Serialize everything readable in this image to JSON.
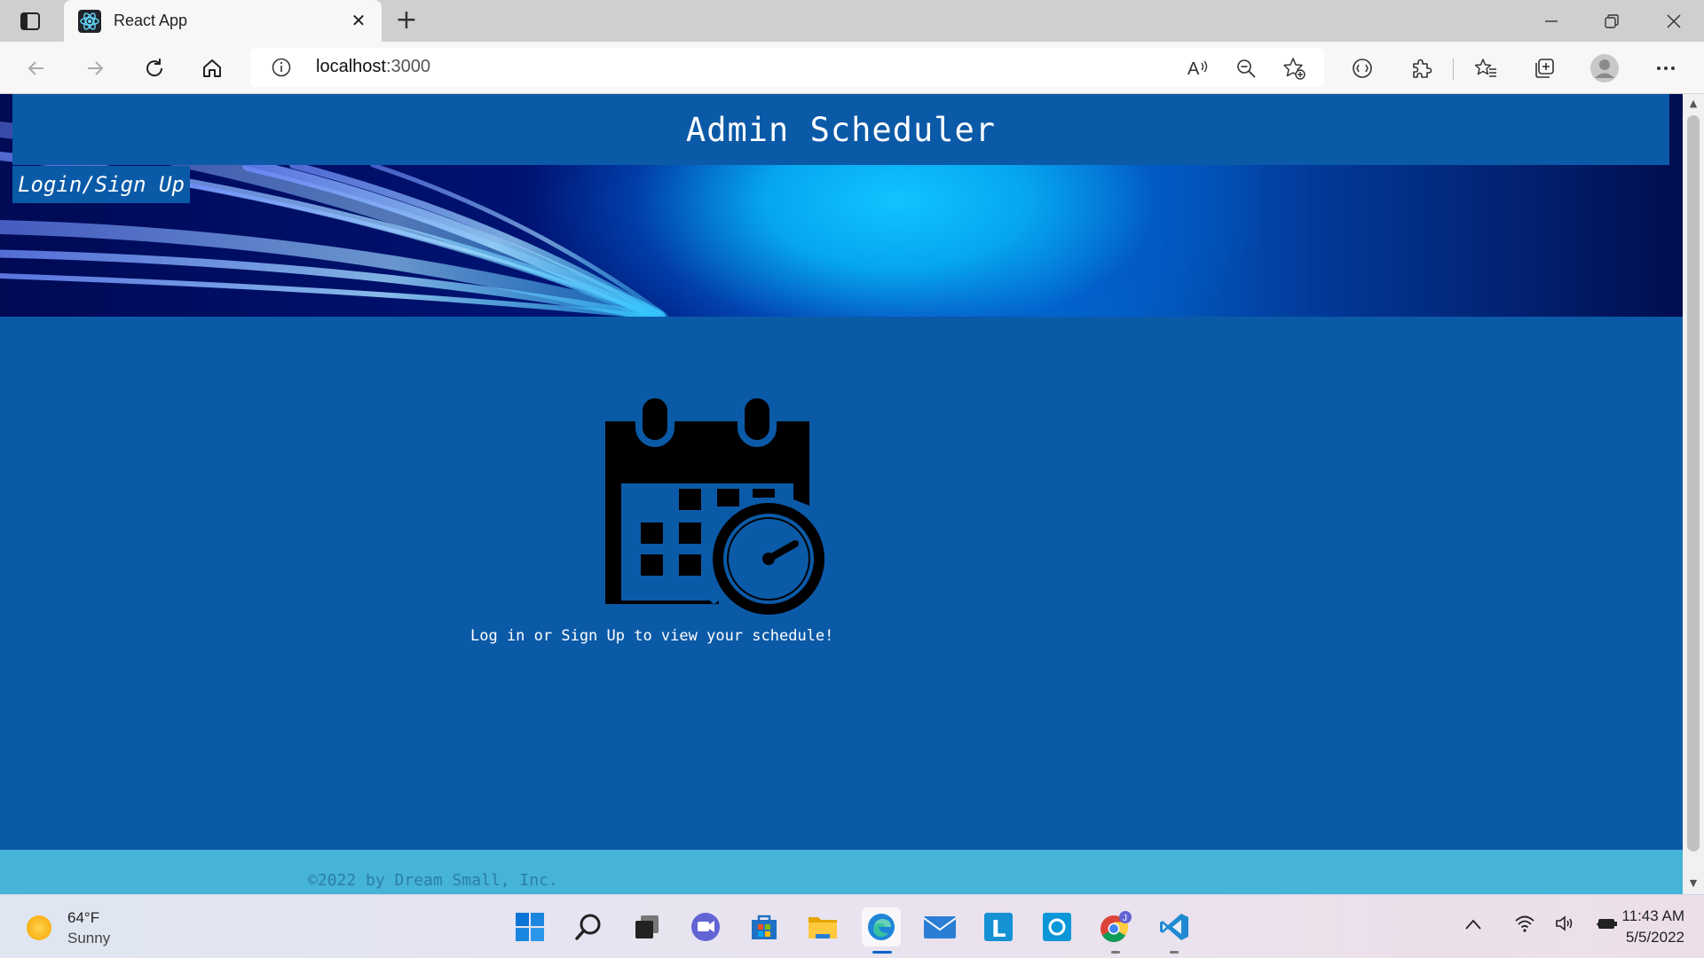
{
  "browser": {
    "tab_title": "React App",
    "new_tab_symbol": "+",
    "close_tab_symbol": "✕",
    "url_host": "localhost",
    "url_port": ":3000",
    "icons": [
      "tab-actions-icon",
      "react-favicon-icon",
      "minimize-icon",
      "restore-icon",
      "close-window-icon",
      "back-icon",
      "forward-icon",
      "refresh-icon",
      "home-icon",
      "site-info-icon",
      "read-aloud-icon",
      "zoom-out-icon",
      "add-favorite-icon",
      "tracking-icon",
      "extensions-icon",
      "favorites-icon",
      "collections-icon",
      "profile-icon",
      "more-icon"
    ]
  },
  "page": {
    "title": "Admin Scheduler",
    "login_label": "Login/Sign Up",
    "prompt": "Log in or Sign Up to view your schedule!",
    "footer": "©2022 by Dream Small, Inc.",
    "colors": {
      "primary": "#0b5aa8",
      "footer": "#46b3d8",
      "footer_text": "#2c7ea6"
    }
  },
  "taskbar": {
    "weather_temp": "64°F",
    "weather_desc": "Sunny",
    "time": "11:43 AM",
    "date": "5/5/2022",
    "apps": [
      "windows-start",
      "search",
      "task-view",
      "teams-chat",
      "microsoft-store",
      "file-explorer",
      "edge",
      "mail",
      "app-l",
      "cortana",
      "chrome",
      "vscode"
    ]
  }
}
